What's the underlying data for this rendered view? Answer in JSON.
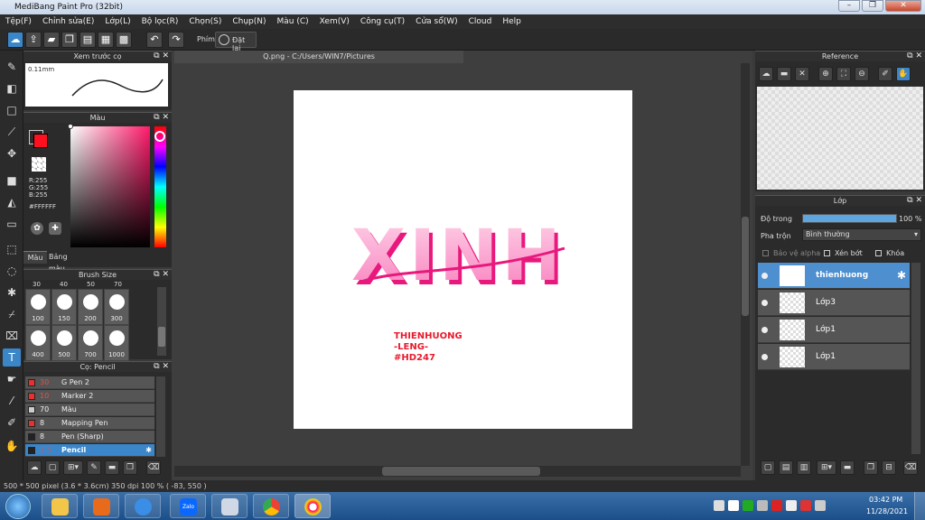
{
  "app": {
    "title": "MediBang Paint Pro (32bit)",
    "window_buttons": [
      "–",
      "❐",
      "✕"
    ]
  },
  "menu": [
    "Tệp(F)",
    "Chỉnh sửa(E)",
    "Lớp(L)",
    "Bộ lọc(R)",
    "Chọn(S)",
    "Chụp(N)",
    "Màu (C)",
    "Xem(V)",
    "Công cụ(T)",
    "Cửa sổ(W)",
    "Cloud",
    "Help"
  ],
  "toolbar": {
    "key_label": "Phím",
    "reset_label": "Đặt lại"
  },
  "brush_preview_panel": {
    "title": "Xem trước cọ",
    "size": "0.11mm"
  },
  "color_panel": {
    "title": "Màu",
    "r": "R:255",
    "g": "G:255",
    "b": "B:255",
    "hex": "#FFFFFF",
    "tab_color": "Màu",
    "tab_palette": "Bảng màu",
    "primary_color": "#ff1020",
    "secondary_color": "#ffffff"
  },
  "brush_size_panel": {
    "title": "Brush Size",
    "top_row": [
      "30",
      "40",
      "50",
      "70"
    ],
    "rows": [
      [
        "100",
        "150",
        "200",
        "300"
      ],
      [
        "400",
        "500",
        "700",
        "1000"
      ]
    ]
  },
  "brush_panel": {
    "title": "Cọ: Pencil",
    "items": [
      {
        "size": "30",
        "name": "G Pen 2",
        "color": "#e83030"
      },
      {
        "size": "10",
        "name": "Marker 2",
        "color": "#e83030"
      },
      {
        "size": "70",
        "name": "Màu",
        "color": "#cccccc"
      },
      {
        "size": "8",
        "name": "Mapping Pen",
        "color": "#e83030"
      },
      {
        "size": "8",
        "name": "Pen (Sharp)",
        "color": "#222222"
      },
      {
        "size": "1.5",
        "name": "Pencil",
        "color": "#222222"
      }
    ]
  },
  "document": {
    "tab": "Q.png - C:/Users/WIN7/Pictures",
    "art_text": "XINH",
    "credit_lines": [
      "THIENHUONG",
      "-LENG-",
      "#HD247"
    ]
  },
  "reference_panel": {
    "title": "Reference"
  },
  "layer_panel": {
    "title": "Lớp",
    "opacity_label": "Độ trong",
    "opacity_value": "100 %",
    "opacity": 1.0,
    "blend_label": "Pha trộn",
    "blend_value": "Bình thường",
    "protect_alpha": "Bảo vệ alpha",
    "clipping": "Xén bớt",
    "lock": "Khóa",
    "layers": [
      {
        "name": "thienhuong",
        "selected": true
      },
      {
        "name": "Lớp3",
        "selected": false
      },
      {
        "name": "Lớp1",
        "selected": false
      },
      {
        "name": "Lớp1",
        "selected": false
      }
    ]
  },
  "status": {
    "text": "500 * 500 pixel   (3.6 * 3.6cm)   350 dpi   100 %   ( -83, 550 )"
  },
  "taskbar": {
    "time": "03:42 PM",
    "date": "11/28/2021",
    "zalo": "Zalo"
  }
}
